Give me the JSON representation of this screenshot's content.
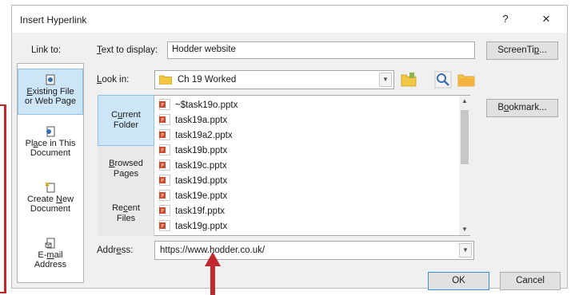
{
  "dialog": {
    "title": "Insert Hyperlink",
    "help_glyph": "?",
    "close_glyph": "×"
  },
  "link_to": {
    "label": "Link to:",
    "items": [
      {
        "line1_pre": "",
        "line1_ul": "E",
        "line1_post": "xisting File",
        "line2": "or Web Page",
        "icon": "web-page-icon",
        "active": true
      },
      {
        "line1_pre": "Pl",
        "line1_ul": "a",
        "line1_post": "ce in This",
        "line2": "Document",
        "icon": "place-in-document-icon",
        "active": false
      },
      {
        "line1_pre": "Create ",
        "line1_ul": "N",
        "line1_post": "ew",
        "line2": "Document",
        "icon": "new-document-icon",
        "active": false
      },
      {
        "line1_pre": "E-",
        "line1_ul": "m",
        "line1_post": "ail",
        "line2": "Address",
        "icon": "email-icon",
        "active": false
      }
    ]
  },
  "text_to_display": {
    "label_ul": "T",
    "label_rest": "ext to display:",
    "value": "Hodder website"
  },
  "screentip_button": {
    "pre": "ScreenTi",
    "ul": "p",
    "post": "..."
  },
  "look_in": {
    "label_ul": "L",
    "label_rest": "ook in:",
    "value": "Ch 19 Worked"
  },
  "places": [
    {
      "pre": "C",
      "ul": "u",
      "post": "rrent",
      "line2": "Folder",
      "active": true
    },
    {
      "pre": "",
      "ul": "B",
      "post": "rowsed",
      "line2": "Pages",
      "active": false
    },
    {
      "pre": "Re",
      "ul": "c",
      "post": "ent",
      "line2": "Files",
      "active": false
    }
  ],
  "files": [
    "~$task19o.pptx",
    "task19a.pptx",
    "task19a2.pptx",
    "task19b.pptx",
    "task19c.pptx",
    "task19d.pptx",
    "task19e.pptx",
    "task19f.pptx",
    "task19g.pptx"
  ],
  "bookmark_button": {
    "pre": "B",
    "ul": "o",
    "post": "okmark..."
  },
  "address": {
    "label_pre": "Addr",
    "label_ul": "e",
    "label_post": "ss:",
    "value": "https://www.hodder.co.uk/"
  },
  "ok_button": "OK",
  "cancel_button": "Cancel",
  "colors": {
    "accent_selection": "#cde6f7",
    "annotation_red": "#c0282e",
    "folder_yellow": "#f2c744",
    "ppt_orange": "#d24726"
  }
}
